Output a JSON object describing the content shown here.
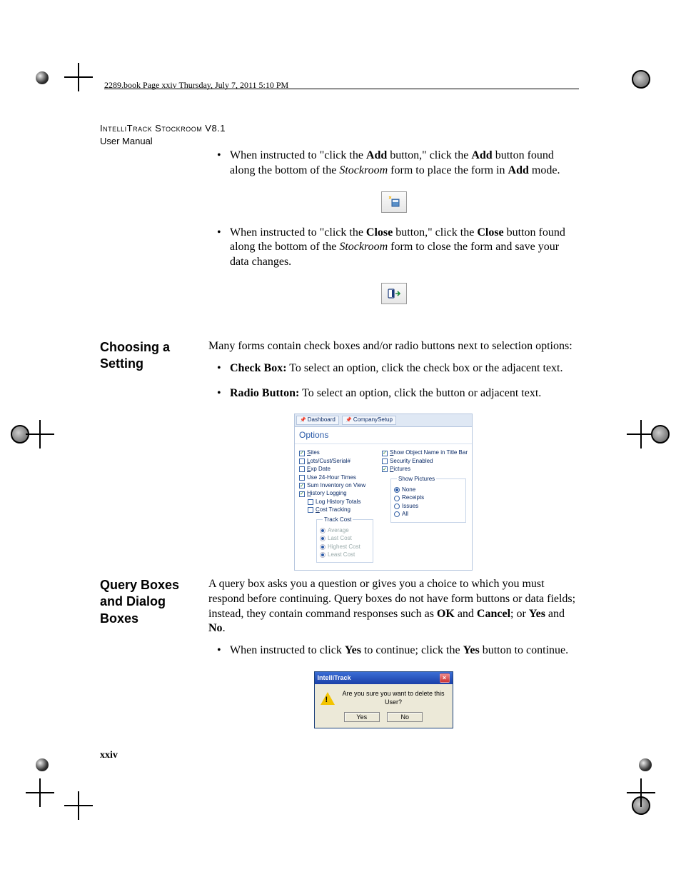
{
  "header_line": "2289.book  Page xxiv  Thursday, July 7, 2011  5:10 PM",
  "doc_title": "IntelliTrack Stockroom V8.1",
  "doc_subtitle": "User Manual",
  "page_number": "xxiv",
  "section1": {
    "bullet1_a": "When instructed to \"click the ",
    "bullet1_b": "Add",
    "bullet1_c": " button,\" click the ",
    "bullet1_d": "Add",
    "bullet1_e": " button found along the bottom of the ",
    "bullet1_f": "Stockroom",
    "bullet1_g": " form to place the form in ",
    "bullet1_h": "Add",
    "bullet1_i": " mode.",
    "bullet2_a": "When instructed to \"click the ",
    "bullet2_b": "Close",
    "bullet2_c": " button,\" click the ",
    "bullet2_d": "Close",
    "bullet2_e": " button found along the bottom of the ",
    "bullet2_f": "Stockroom",
    "bullet2_g": " form to close the form and save your data changes."
  },
  "section2": {
    "heading": "Choosing a Setting",
    "intro": "Many forms contain check boxes and/or radio buttons next to selection options:",
    "b1_label": "Check Box:",
    "b1_text": " To select an option, click the check box or the adjacent text.",
    "b2_label": "Radio Button:",
    "b2_text": " To select an option, click the button or adjacent text."
  },
  "options_fig": {
    "tab1": "Dashboard",
    "tab2": "CompanySetup",
    "title": "Options",
    "left": {
      "sites": "Sites",
      "lots": "Lots/Cust/Serial#",
      "exp": "Exp Date",
      "h24": "Use 24-Hour Times",
      "suminv": "Sum Inventory on View",
      "histlog": "History Logging",
      "loghist": "Log History Totals",
      "costtrack": "Cost Tracking",
      "trackcost_group": "Track Cost",
      "avg": "Average",
      "last": "Last Cost",
      "high": "Highest Cost",
      "least": "Least Cost"
    },
    "right": {
      "showobj": "Show Object Name in Title Bar",
      "sec": "Security Enabled",
      "pics": "Pictures",
      "showpics_group": "Show Pictures",
      "none": "None",
      "rec": "Receipts",
      "iss": "Issues",
      "all": "All"
    }
  },
  "section3": {
    "heading": "Query Boxes and Dialog Boxes",
    "p_a": "A query box asks you a question or gives you a choice to which you must respond before continuing. Query boxes do not have form buttons or data fields; instead, they contain command responses such as ",
    "p_b": "OK",
    "p_c": " and ",
    "p_d": "Cancel",
    "p_e": "; or ",
    "p_f": "Yes",
    "p_g": " and ",
    "p_h": "No",
    "p_i": ".",
    "bullet_a": "When instructed to click ",
    "bullet_b": "Yes",
    "bullet_c": " to continue; click the ",
    "bullet_d": "Yes",
    "bullet_e": " button to continue."
  },
  "dialog": {
    "title": "IntelliTrack",
    "msg": "Are you sure you want to delete this User?",
    "yes": "Yes",
    "no": "No"
  }
}
